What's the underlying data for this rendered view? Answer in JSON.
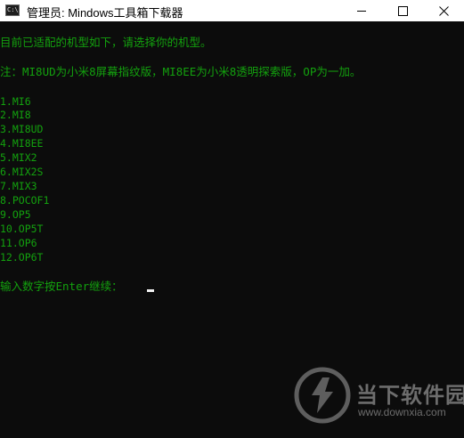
{
  "window": {
    "title": "管理员:  Mindows工具箱下载器",
    "icon": "console-app-icon",
    "icon_text": "C:\\"
  },
  "console": {
    "intro": "目前已适配的机型如下，请选择你的机型。",
    "note": "注：MI8UD为小米8屏幕指纹版，MI8EE为小米8透明探索版，OP为一加。",
    "options": [
      "1.MI6",
      "2.MI8",
      "3.MI8UD",
      "4.MI8EE",
      "5.MIX2",
      "6.MIX2S",
      "7.MIX3",
      "8.POCOF1",
      "9.OP5",
      "10.OP5T",
      "11.OP6",
      "12.OP6T"
    ],
    "prompt": "输入数字按Enter继续："
  },
  "watermark": {
    "name": "当下软件园",
    "url": "www.downxia.com"
  },
  "colors": {
    "console_bg": "#0c0c0c",
    "console_text": "#13a10e",
    "cursor": "#f2f2f2",
    "titlebar_bg": "#ffffff"
  }
}
